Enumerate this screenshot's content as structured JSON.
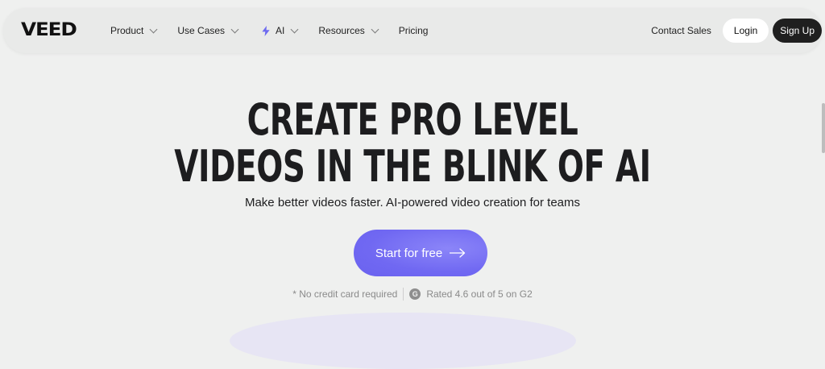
{
  "brand": {
    "logo_text": "VEED"
  },
  "nav": {
    "items": [
      {
        "label": "Product",
        "has_dropdown": true
      },
      {
        "label": "Use Cases",
        "has_dropdown": true
      },
      {
        "label": "AI",
        "has_dropdown": true,
        "icon": "lightning-bolt-icon"
      },
      {
        "label": "Resources",
        "has_dropdown": true
      },
      {
        "label": "Pricing",
        "has_dropdown": false
      }
    ],
    "contact_label": "Contact Sales",
    "login_label": "Login",
    "signup_label": "Sign Up"
  },
  "hero": {
    "title_line1": "CREATE PRO LEVEL",
    "title_line2": "VIDEOS IN THE BLINK OF AI",
    "subtitle": "Make better videos faster. AI-powered video creation for teams",
    "cta_label": "Start for free",
    "note_left": "* No credit card required",
    "g2_glyph": "G",
    "note_right": "Rated 4.6 out of 5 on G2"
  },
  "colors": {
    "background": "#eff0ef",
    "cta": "#7068f2",
    "signup_bg": "#1f1f1f",
    "ai_bolt": "#6d6af0"
  }
}
